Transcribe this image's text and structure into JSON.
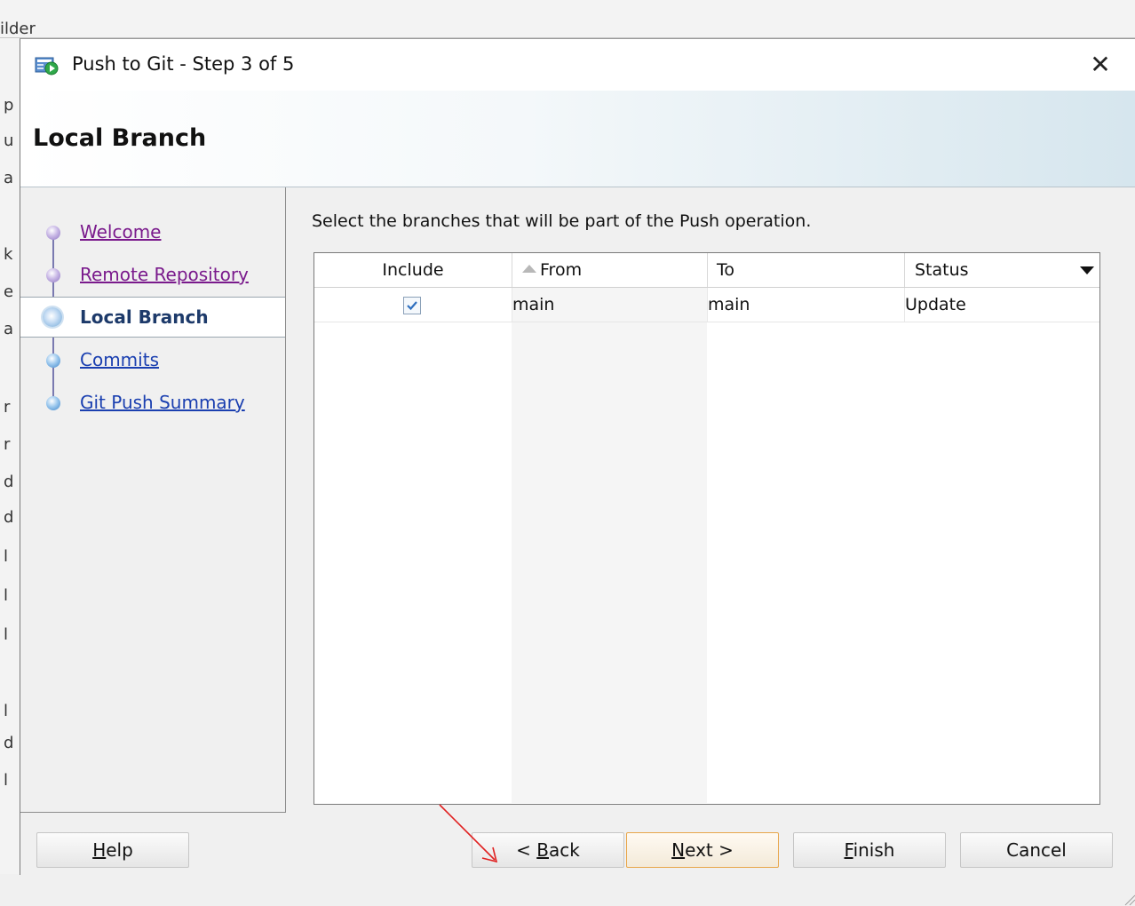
{
  "background_app": {
    "title_fragment": "ilder",
    "side_fragments": [
      "p",
      "u",
      "a",
      "k",
      "e",
      "a",
      "r",
      "r",
      "d",
      "d",
      "l",
      "l",
      "l",
      "l",
      "d",
      "l"
    ]
  },
  "dialog": {
    "title": "Push to Git - Step 3 of 5",
    "header_title": "Local Branch",
    "close_glyph": "✕"
  },
  "steps": [
    {
      "label": "Welcome",
      "state": "visited"
    },
    {
      "label": "Remote Repository",
      "state": "visited"
    },
    {
      "label": "Local Branch",
      "state": "current"
    },
    {
      "label": "Commits",
      "state": "link"
    },
    {
      "label": "Git Push Summary",
      "state": "link"
    }
  ],
  "content": {
    "instruction": "Select the branches that will be part of the Push operation."
  },
  "table": {
    "columns": [
      "Include",
      "From",
      "To",
      "Status"
    ],
    "sorted_column": "From",
    "rows": [
      {
        "include": true,
        "from": "main",
        "to": "main",
        "status": "Update"
      }
    ]
  },
  "buttons": {
    "help": {
      "label": "Help",
      "mnemonic": "H",
      "rest": "elp"
    },
    "back": {
      "pre": "< ",
      "mnemonic": "B",
      "rest": "ack"
    },
    "next": {
      "mnemonic": "N",
      "rest": "ext >"
    },
    "finish": {
      "mnemonic": "F",
      "rest": "inish"
    },
    "cancel": {
      "label": "Cancel"
    }
  },
  "colors": {
    "visited_link": "#7a1a8c",
    "link": "#1a3fb0",
    "current_step": "#1d3a6a",
    "default_button_border": "#e8a64a",
    "annotation_arrow": "#e02020"
  },
  "icons": {
    "title_icon": "push-to-git-icon",
    "close": "close-icon",
    "checkbox": "checkmark-icon",
    "sort": "sort-ascending-icon",
    "column_menu": "chevron-down-icon"
  }
}
